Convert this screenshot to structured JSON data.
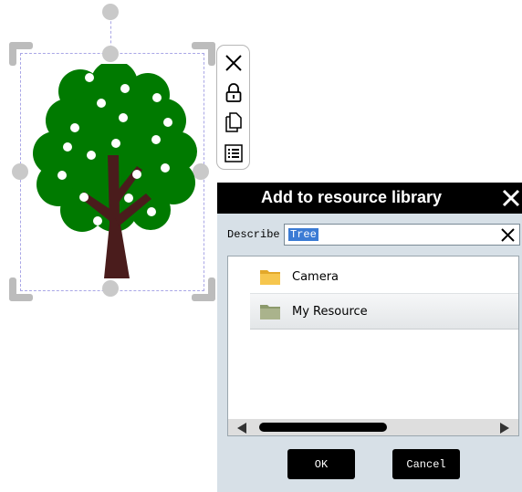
{
  "dialog": {
    "title": "Add to resource library",
    "describe_label": "Describe",
    "describe_value": "Tree",
    "folders": [
      {
        "label": "Camera",
        "selected": false
      },
      {
        "label": "My Resource",
        "selected": true
      }
    ],
    "ok_label": "OK",
    "cancel_label": "Cancel"
  },
  "object_toolbar": {
    "items": [
      "close-icon",
      "lock-icon",
      "copy-icon",
      "list-icon"
    ]
  },
  "colors": {
    "tree_foliage": "#007a00",
    "tree_trunk": "#4a1c1c",
    "selection_outline": "#a9a6e6",
    "dialog_titlebar": "#000000",
    "dialog_body": "#d7e0e7"
  }
}
